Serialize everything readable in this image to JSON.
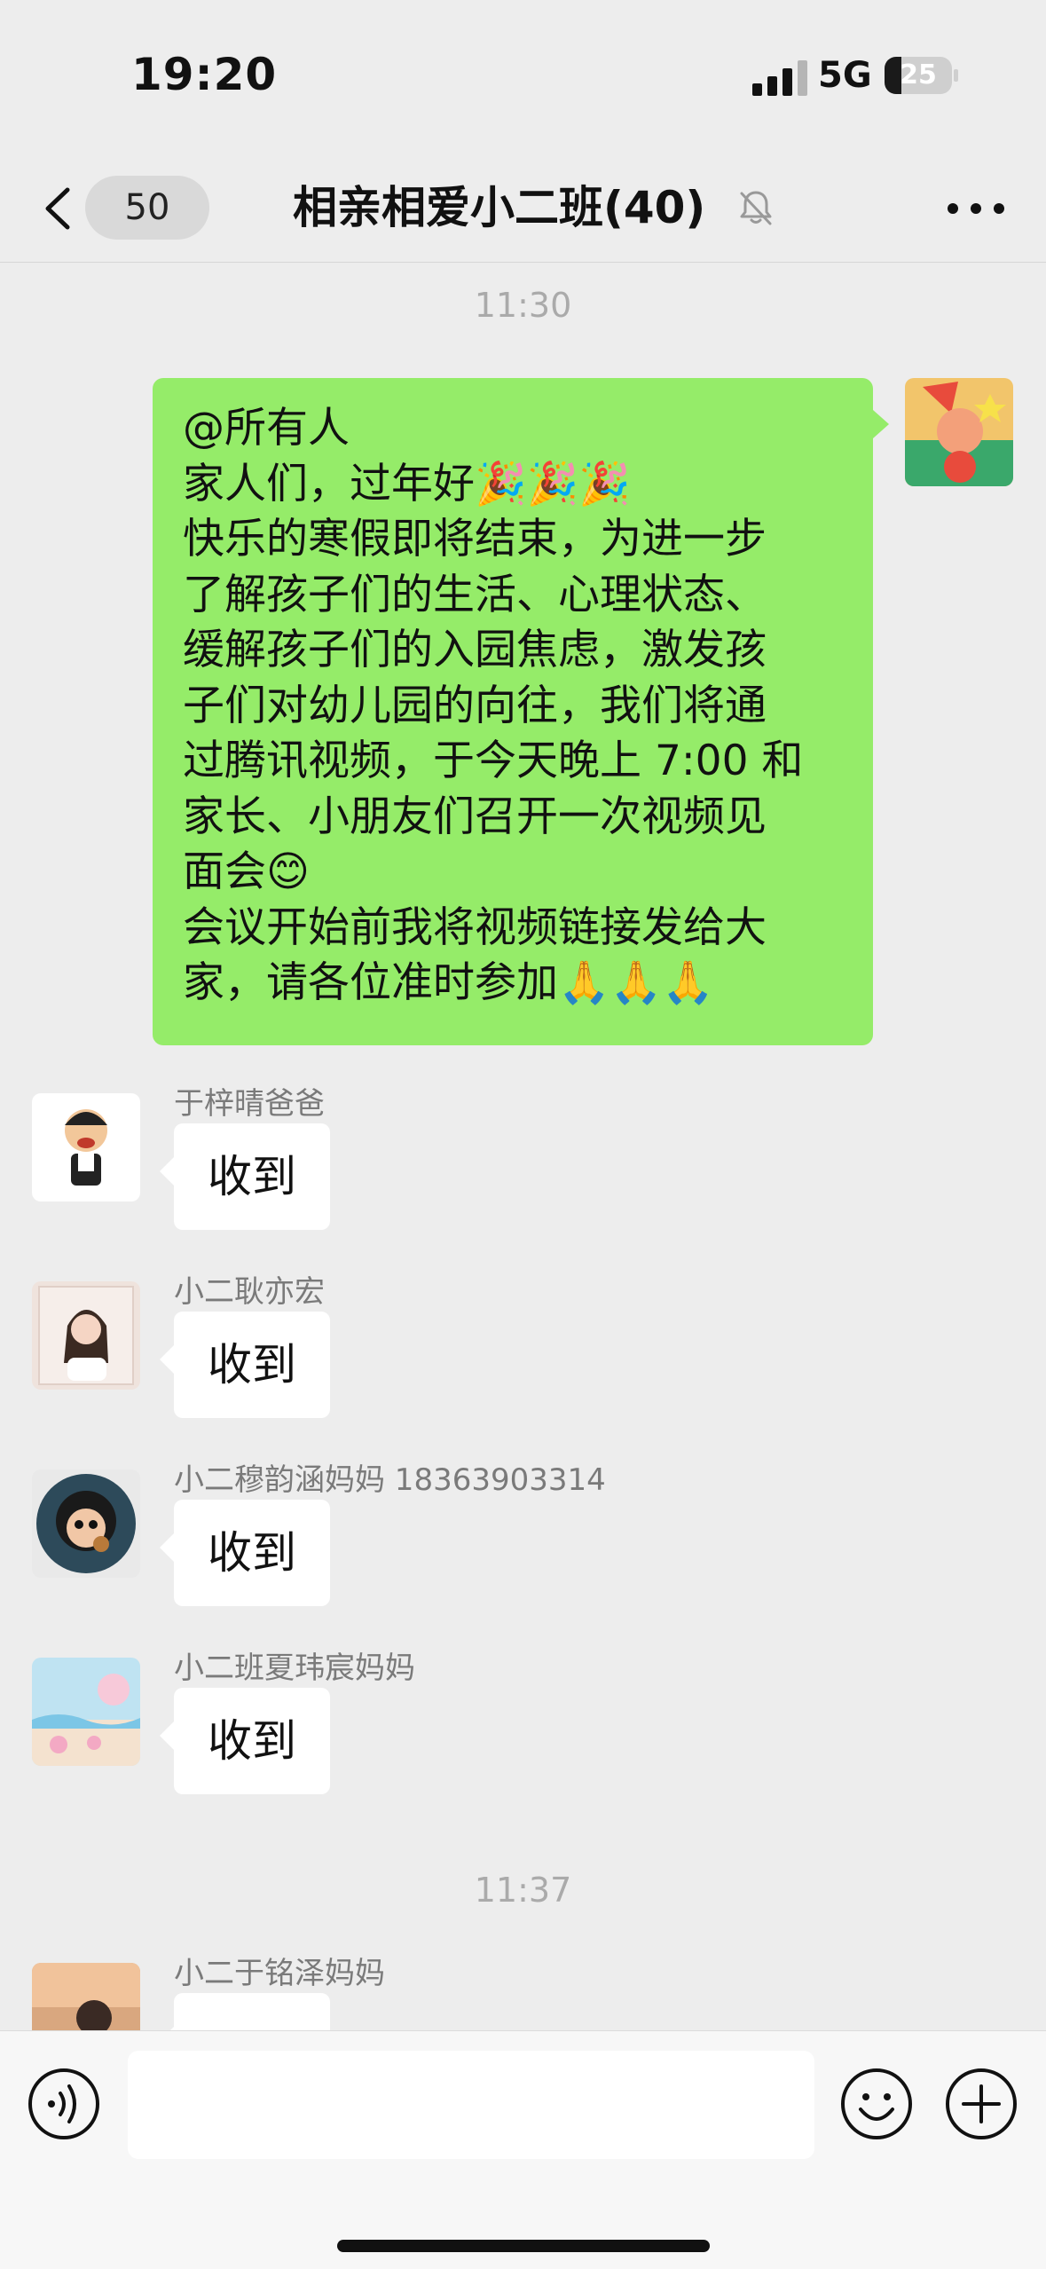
{
  "status_bar": {
    "time": "19:20",
    "network": "5G",
    "battery": "25",
    "battery_level": 0.25
  },
  "header": {
    "unread_count": "50",
    "title": "相亲相爱小二班(40)"
  },
  "messages": [
    {
      "type": "timestamp",
      "text": "11:30"
    },
    {
      "type": "outgoing",
      "lines": [
        "@所有人",
        "家人们，过年好🎉🎉🎉",
        "快乐的寒假即将结束，为进一步",
        "了解孩子们的生活、心理状态、",
        "缓解孩子们的入园焦虑，激发孩",
        "子们对幼儿园的向往，我们将通",
        "过腾讯视频，于今天晚上 7:00 和",
        "家长、小朋友们召开一次视频见",
        "面会😊",
        "会议开始前我将视频链接发给大",
        "家，请各位准时参加🙏🙏🙏"
      ]
    },
    {
      "type": "incoming",
      "sender": "于梓晴爸爸",
      "text": "收到"
    },
    {
      "type": "incoming",
      "sender": "小二耿亦宏",
      "text": "收到"
    },
    {
      "type": "incoming",
      "sender": "小二穆韵涵妈妈 18363903314",
      "text": "收到"
    },
    {
      "type": "incoming",
      "sender": "小二班夏玮宸妈妈",
      "text": "收到"
    },
    {
      "type": "timestamp",
      "text": "11:37"
    },
    {
      "type": "incoming",
      "sender": "小二于铭泽妈妈",
      "text": ""
    }
  ],
  "input": {
    "placeholder": ""
  },
  "icons": {
    "back": "chevron-left-icon",
    "mute": "bell-mute-icon",
    "more": "more-dots-icon",
    "voice": "voice-icon",
    "emoji": "smiley-icon",
    "plus": "plus-icon"
  },
  "colors": {
    "background": "#ededed",
    "outgoing_bubble": "#95ec69",
    "incoming_bubble": "#ffffff"
  }
}
